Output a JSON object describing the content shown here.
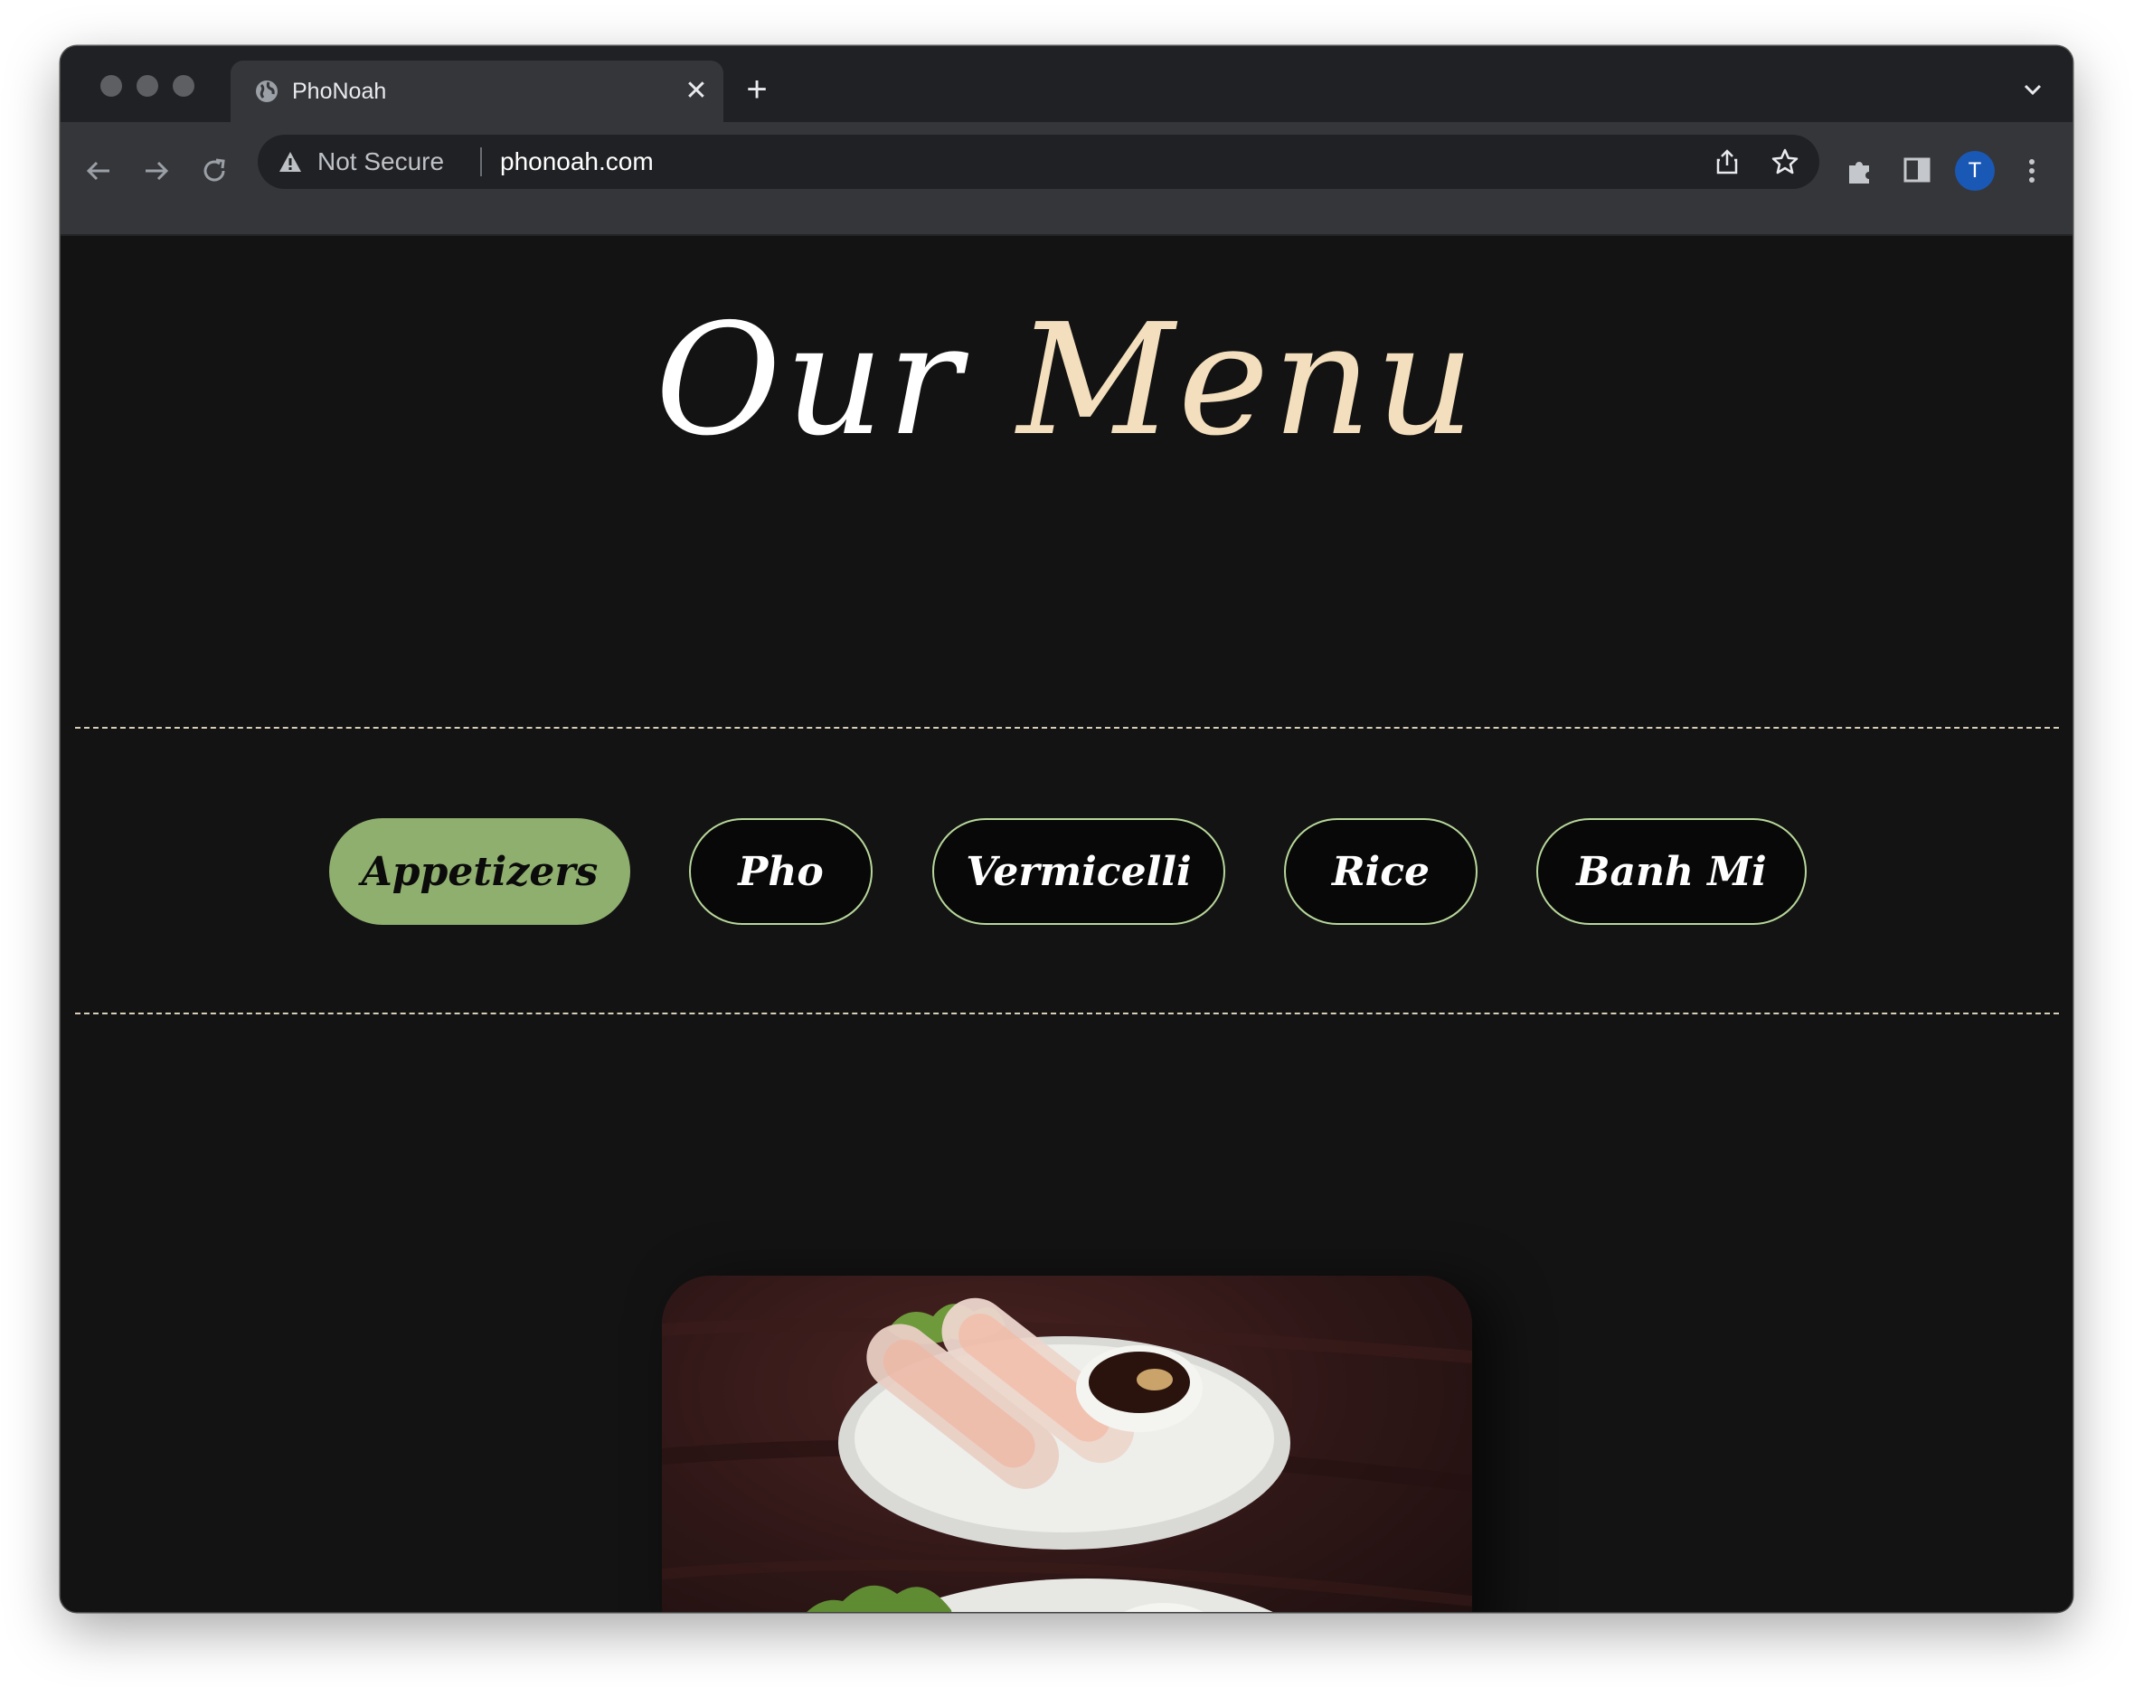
{
  "browser": {
    "tab_title": "PhoNoah",
    "security_label": "Not Secure",
    "url": "phonoah.com",
    "avatar_initial": "T"
  },
  "page": {
    "title_word1": "Our",
    "title_word2": "Menu",
    "categories": [
      {
        "label": "Appetizers",
        "active": true
      },
      {
        "label": "Pho",
        "active": false
      },
      {
        "label": "Vermicelli",
        "active": false
      },
      {
        "label": "Rice",
        "active": false
      },
      {
        "label": "Banh Mi",
        "active": false
      }
    ]
  },
  "colors": {
    "page_bg": "#131313",
    "accent_green": "#8faf6f",
    "title_cream": "#f3dfbd",
    "pill_border": "#b7d79a"
  }
}
